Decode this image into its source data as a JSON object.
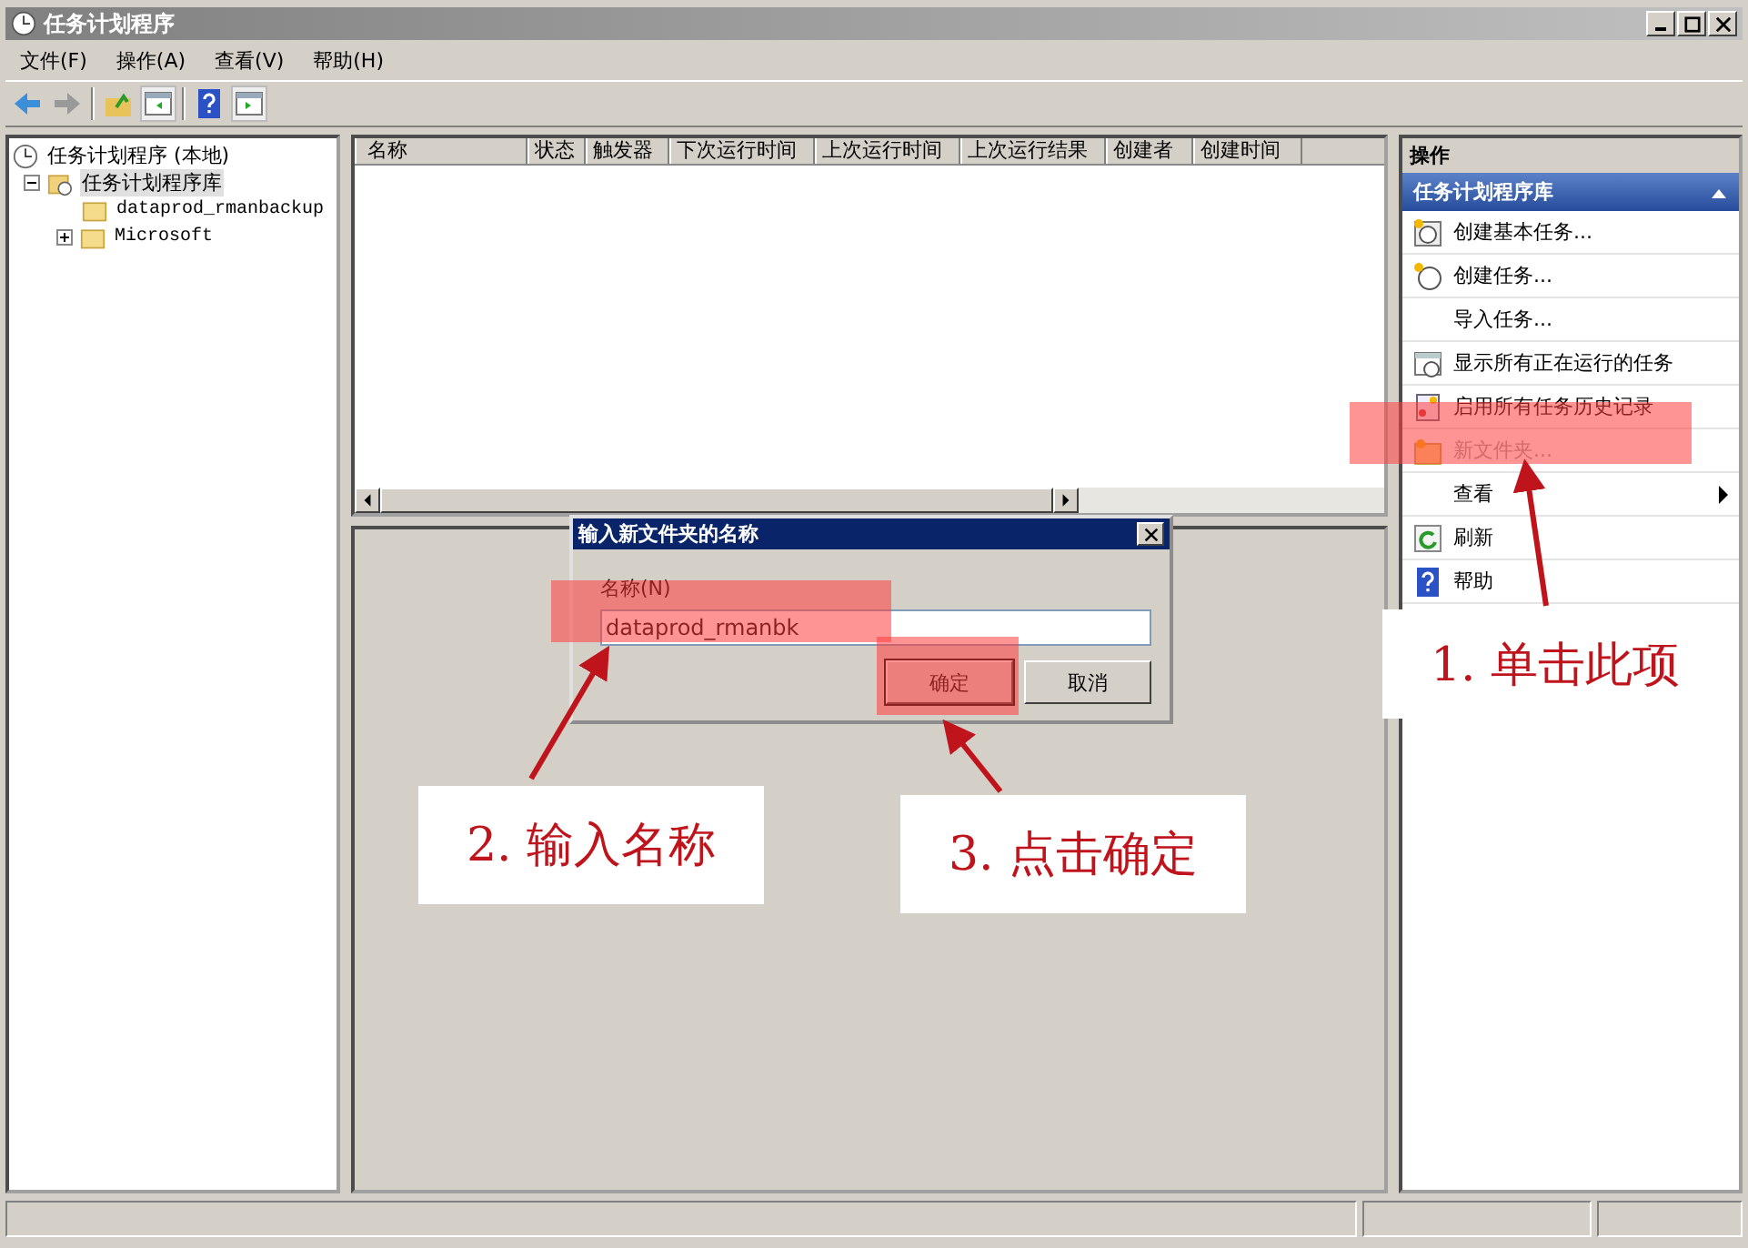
{
  "window": {
    "title": "任务计划程序"
  },
  "menu": [
    "文件(F)",
    "操作(A)",
    "查看(V)",
    "帮助(H)"
  ],
  "tree": [
    {
      "label": "任务计划程序 (本地)",
      "kind": "root",
      "selected": false,
      "children": [
        {
          "label": "任务计划程序库",
          "kind": "library",
          "selected": true,
          "expanded": true,
          "children": [
            {
              "label": "dataprod_rmanbackup",
              "kind": "folder",
              "selected": false
            },
            {
              "label": "Microsoft",
              "kind": "folder",
              "selected": false,
              "expanded": false
            }
          ]
        }
      ]
    }
  ],
  "table": {
    "columns": [
      "名称",
      "状态",
      "触发器",
      "下次运行时间",
      "上次运行时间",
      "上次运行结果",
      "创建者",
      "创建时间"
    ]
  },
  "actions": {
    "title": "操作",
    "section": "任务计划程序库",
    "items": [
      {
        "label": "创建基本任务...",
        "kind": "basic-task",
        "disabled": false
      },
      {
        "label": "创建任务...",
        "kind": "task",
        "disabled": false
      },
      {
        "label": "导入任务...",
        "kind": "plain",
        "disabled": false
      },
      {
        "label": "显示所有正在运行的任务",
        "kind": "running",
        "disabled": false
      },
      {
        "label": "启用所有任务历史记录",
        "kind": "history",
        "disabled": false
      },
      {
        "label": "新文件夹...",
        "kind": "folder",
        "disabled": true
      },
      {
        "label": "查看",
        "kind": "submenu",
        "disabled": false
      },
      {
        "label": "刷新",
        "kind": "refresh",
        "disabled": false
      },
      {
        "label": "帮助",
        "kind": "help",
        "disabled": false
      }
    ]
  },
  "dialog": {
    "title": "输入新文件夹的名称",
    "field_label": "名称(N)",
    "value": "dataprod_rmanbk",
    "buttons": [
      {
        "label": "确定",
        "default": true
      },
      {
        "label": "取消",
        "default": false
      }
    ]
  },
  "annotations": [
    "1. 单击此项",
    "2. 输入名称",
    "3. 点击确定"
  ]
}
